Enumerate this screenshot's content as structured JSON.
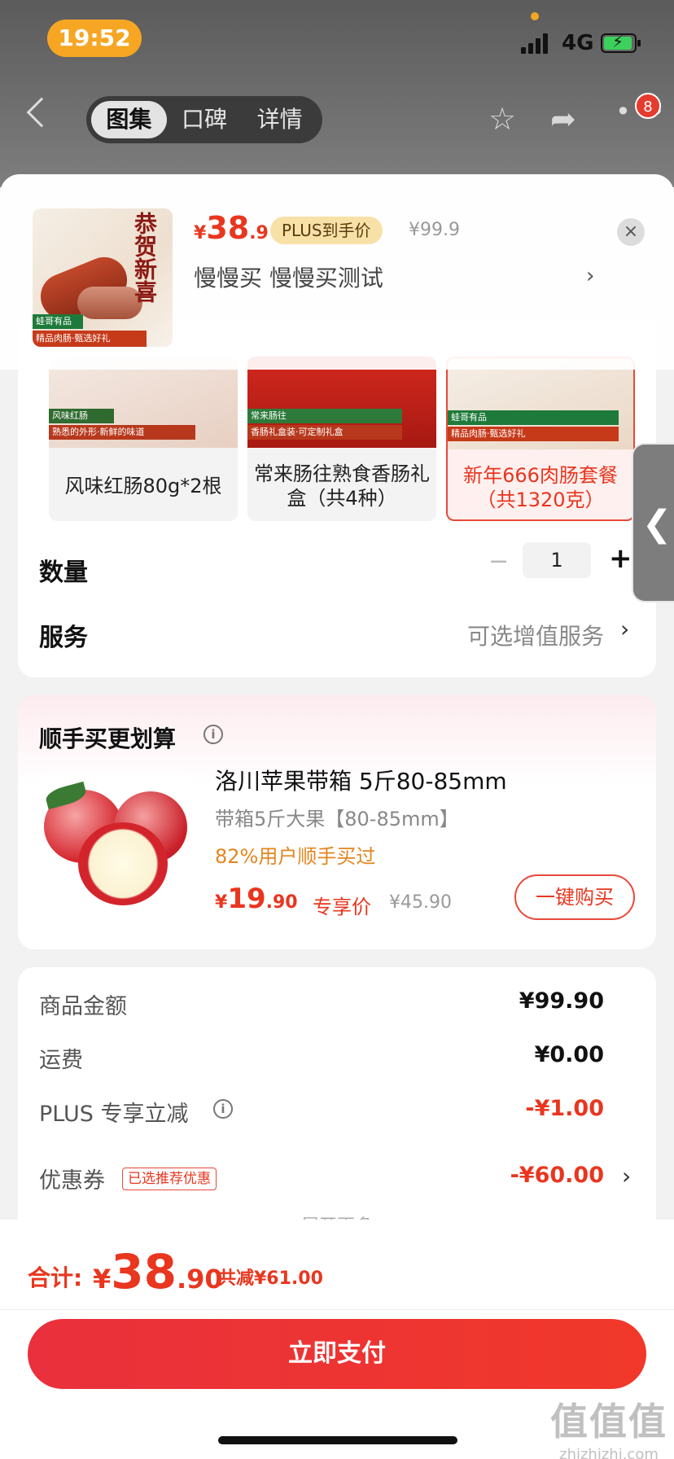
{
  "status_bar": {
    "time": "19:52",
    "network": "4G"
  },
  "nav": {
    "tabs": [
      {
        "label": "图集",
        "active": true
      },
      {
        "label": "口碑",
        "active": false
      },
      {
        "label": "详情",
        "active": false
      }
    ],
    "badge_count": "8"
  },
  "header": {
    "price_symbol": "¥",
    "price_int": "38",
    "price_dec": ".9",
    "plus_tag": "PLUS到手价",
    "original_price": "¥99.9",
    "product_name": "慢慢买  慢慢买测试",
    "arrow": "›",
    "close": "×",
    "image_calligraphy": "恭贺新喜",
    "image_brand": "蛙哥有品",
    "image_slogan": "精品肉肠·甄选好礼"
  },
  "options": [
    {
      "label": "风味红肠80g*2根",
      "badge": "风味红肠",
      "sub": "熟悉的外形·新鲜的味道",
      "selected": false
    },
    {
      "label": "常来肠往熟食香肠礼盒（共4种）",
      "badge": "常来肠往",
      "sub": "香肠礼盒装·可定制礼盒",
      "selected": false
    },
    {
      "label": "新年666肉肠套餐（共1320克）",
      "badge": "蛙哥有品",
      "sub": "精品肉肠·甄选好礼",
      "selected": true
    }
  ],
  "quantity": {
    "label": "数量",
    "minus": "−",
    "value": "1",
    "plus": "+"
  },
  "service": {
    "label": "服务",
    "value": "可选增值服务",
    "arrow": "›"
  },
  "addon": {
    "title": "顺手买更划算",
    "info_icon": "i",
    "product_title": "洛川苹果带箱 5斤80-85mm",
    "spec": "带箱5斤大果【80-85mm】",
    "rate": "82%用户顺手买过",
    "price_symbol": "¥",
    "price_int": "19",
    "price_dec": ".90",
    "price_tag": "专享价",
    "original_price": "¥45.90",
    "buy_label": "一键购买"
  },
  "breakdown": {
    "rows": [
      {
        "label": "商品金额",
        "value": "¥99.90"
      },
      {
        "label": "运费",
        "value": "¥0.00"
      },
      {
        "label": "PLUS 专享立减",
        "value": "-¥1.00"
      },
      {
        "label": "优惠券",
        "value": "-¥60.00",
        "tag": "已选推荐优惠"
      }
    ],
    "expand": "展开更多"
  },
  "footer": {
    "total_label": "合计:",
    "total_symbol": "¥",
    "total_int": "38",
    "total_dec": ".90",
    "saved": "共减¥61.00",
    "pay_label": "立即支付",
    "watermark": "值值值",
    "watermark_url": "zhizhizhi.com"
  },
  "colors": {
    "accent": "#e9361f",
    "plus_tag_bg": "#f7e1a6",
    "status_time_bg": "#f6a623"
  }
}
